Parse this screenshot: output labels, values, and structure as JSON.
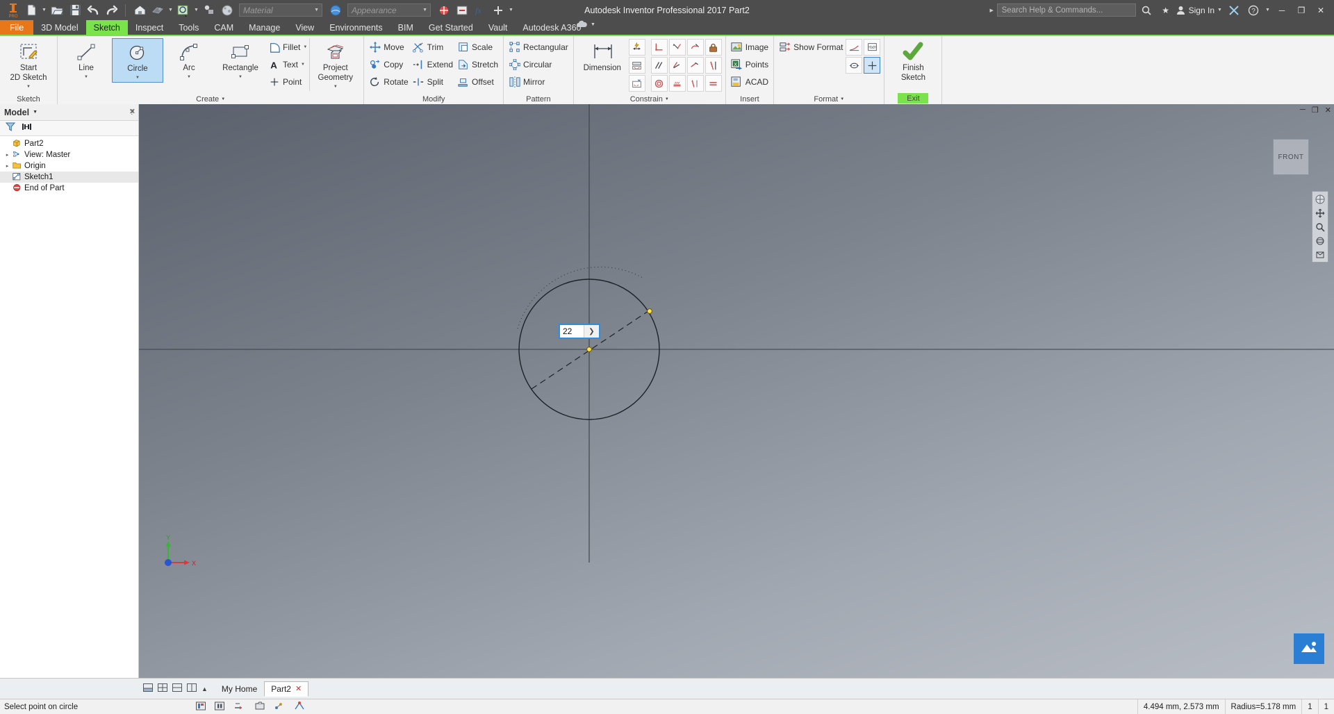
{
  "titlebar": {
    "app_title": "Autodesk Inventor Professional 2017    Part2",
    "material_placeholder": "Material",
    "appearance_placeholder": "Appearance",
    "search_placeholder": "Search Help & Commands...",
    "signin_label": "Sign In",
    "quick_access": [
      {
        "name": "new-document",
        "label": "New"
      },
      {
        "name": "open-document",
        "label": "Open"
      },
      {
        "name": "save-document",
        "label": "Save"
      },
      {
        "name": "undo",
        "label": "Undo"
      },
      {
        "name": "redo",
        "label": "Redo"
      },
      {
        "name": "home",
        "label": "Home"
      },
      {
        "name": "appearance-swatch",
        "label": "Appearance"
      },
      {
        "name": "select",
        "label": "Select"
      },
      {
        "name": "material-sphere",
        "label": "Material"
      }
    ],
    "window_buttons": [
      "minimize",
      "maximize",
      "close"
    ]
  },
  "tabs": [
    {
      "label": "File",
      "state": "file"
    },
    {
      "label": "3D Model",
      "state": "normal"
    },
    {
      "label": "Sketch",
      "state": "active"
    },
    {
      "label": "Inspect",
      "state": "normal"
    },
    {
      "label": "Tools",
      "state": "normal"
    },
    {
      "label": "CAM",
      "state": "normal"
    },
    {
      "label": "Manage",
      "state": "normal"
    },
    {
      "label": "View",
      "state": "normal"
    },
    {
      "label": "Environments",
      "state": "normal"
    },
    {
      "label": "BIM",
      "state": "normal"
    },
    {
      "label": "Get Started",
      "state": "normal"
    },
    {
      "label": "Vault",
      "state": "normal"
    },
    {
      "label": "Autodesk A360",
      "state": "normal"
    }
  ],
  "ribbon": {
    "panels": [
      {
        "title": "Sketch",
        "big": [
          {
            "label1": "Start",
            "label2": "2D Sketch",
            "icon": "start-2d-sketch-icon",
            "dropdown": true,
            "selected": false
          }
        ]
      },
      {
        "title": "Create",
        "title_dropdown": true,
        "big": [
          {
            "label1": "Line",
            "label2": "",
            "icon": "line-icon",
            "dropdown": true,
            "selected": false
          },
          {
            "label1": "Circle",
            "label2": "",
            "icon": "circle-icon",
            "dropdown": true,
            "selected": true
          },
          {
            "label1": "Arc",
            "label2": "",
            "icon": "arc-icon",
            "dropdown": true,
            "selected": false
          },
          {
            "label1": "Rectangle",
            "label2": "",
            "icon": "rectangle-icon",
            "dropdown": true,
            "selected": false
          }
        ],
        "small": [
          {
            "label": "Fillet",
            "icon": "fillet-icon",
            "dropdown": true
          },
          {
            "label": "Text",
            "icon": "text-icon",
            "dropdown": true
          },
          {
            "label": "Point",
            "icon": "point-icon",
            "dropdown": false
          }
        ],
        "big2": [
          {
            "label1": "Project",
            "label2": "Geometry",
            "icon": "project-geometry-icon",
            "dropdown": true,
            "selected": false
          }
        ]
      },
      {
        "title": "Modify",
        "small_cols": [
          [
            {
              "label": "Move",
              "icon": "move-icon"
            },
            {
              "label": "Copy",
              "icon": "copy-icon"
            },
            {
              "label": "Rotate",
              "icon": "rotate-icon"
            }
          ],
          [
            {
              "label": "Trim",
              "icon": "trim-icon"
            },
            {
              "label": "Extend",
              "icon": "extend-icon"
            },
            {
              "label": "Split",
              "icon": "split-icon"
            }
          ],
          [
            {
              "label": "Scale",
              "icon": "scale-icon"
            },
            {
              "label": "Stretch",
              "icon": "stretch-icon"
            },
            {
              "label": "Offset",
              "icon": "offset-icon"
            }
          ]
        ]
      },
      {
        "title": "Pattern",
        "small_cols": [
          [
            {
              "label": "Rectangular",
              "icon": "rectangular-pattern-icon"
            },
            {
              "label": "Circular",
              "icon": "circular-pattern-icon"
            },
            {
              "label": "Mirror",
              "icon": "mirror-icon"
            }
          ]
        ]
      },
      {
        "title": "Constrain",
        "title_dropdown": true,
        "big": [
          {
            "label1": "Dimension",
            "label2": "",
            "icon": "dimension-icon",
            "dropdown": false,
            "selected": false
          }
        ],
        "icon_cols": [
          [
            "auto-dimension-icon",
            "dimension-display-icon",
            "dimension-settings-icon"
          ],
          [
            "perpendicular-constraint-icon",
            "parallel-constraint-icon",
            "tangent-constraint-icon"
          ],
          [
            "coincident-constraint-icon",
            "collinear-constraint-icon",
            "smooth-constraint-icon"
          ],
          [
            "concentric-constraint-icon",
            "horizontal-constraint-icon",
            "symmetric-constraint-icon"
          ],
          [
            "fix-constraint-icon",
            "vertical-constraint-icon",
            "equal-constraint-icon"
          ]
        ]
      },
      {
        "title": "Insert",
        "small_cols": [
          [
            {
              "label": "Image",
              "icon": "image-icon"
            },
            {
              "label": "Points",
              "icon": "points-excel-icon"
            },
            {
              "label": "ACAD",
              "icon": "acad-import-icon"
            }
          ]
        ]
      },
      {
        "title": "Format",
        "title_dropdown": true,
        "icon_rows": [
          [
            {
              "icon": "construction-line-icon",
              "selected": false
            },
            {
              "icon": "driven-dimension-icon",
              "selected": false
            }
          ],
          [
            {
              "icon": "centerline-icon",
              "selected": false
            },
            {
              "icon": "center-point-icon",
              "selected": true
            }
          ]
        ],
        "small": [
          {
            "label": "Show Format",
            "icon": "show-format-icon",
            "dropdown": false
          }
        ]
      },
      {
        "title": "Exit",
        "title_highlight": "#7ae24b",
        "big": [
          {
            "label1": "Finish",
            "label2": "Sketch",
            "icon": "finish-sketch-icon",
            "dropdown": false,
            "selected": false
          }
        ]
      }
    ]
  },
  "browser": {
    "header_label": "Model",
    "tools": [
      "filter-icon",
      "find-icon"
    ],
    "help_icon": "help-icon",
    "close_icon": "close-icon",
    "tree": [
      {
        "label": "Part2",
        "icon": "part-icon",
        "indent": 0,
        "twist": "",
        "selected": false
      },
      {
        "label": "View: Master",
        "icon": "view-master-icon",
        "indent": 0,
        "twist": "▸",
        "selected": false
      },
      {
        "label": "Origin",
        "icon": "folder-icon",
        "indent": 0,
        "twist": "▸",
        "selected": false
      },
      {
        "label": "Sketch1",
        "icon": "sketch-icon",
        "indent": 0,
        "twist": "",
        "selected": true
      },
      {
        "label": "End of Part",
        "icon": "end-of-part-icon",
        "indent": 0,
        "twist": "",
        "selected": false
      }
    ]
  },
  "canvas": {
    "view_cube_label": "FRONT",
    "dimension_input_value": "22",
    "dimension_input_caret": "❯",
    "axis_label_y": "Y",
    "axis_label_x": "X",
    "nav_buttons": [
      "full-navigation-wheel-icon",
      "pan-icon",
      "zoom-icon",
      "orbit-icon",
      "look-at-icon"
    ],
    "window_buttons": [
      "minimize",
      "restore",
      "close"
    ]
  },
  "view_tabs": {
    "layout_icons": [
      "tile-icon",
      "grid-icon",
      "horizontal-split-icon",
      "vertical-split-icon"
    ],
    "scroll_up_icon": "▲",
    "tabs": [
      {
        "label": "My Home",
        "active": false,
        "closable": false
      },
      {
        "label": "Part2",
        "active": true,
        "closable": true,
        "close_icon": "✕"
      }
    ]
  },
  "statusbar": {
    "message": "Select point on circle",
    "center_icons": [
      "record-icon",
      "pause-icon",
      "step-icon",
      "camera-icon",
      "points-icon",
      "snap-icon"
    ],
    "coordinates": "4.494 mm, 2.573 mm",
    "radius": "Radius=5.178 mm",
    "field_a": "1",
    "field_b": "1"
  }
}
